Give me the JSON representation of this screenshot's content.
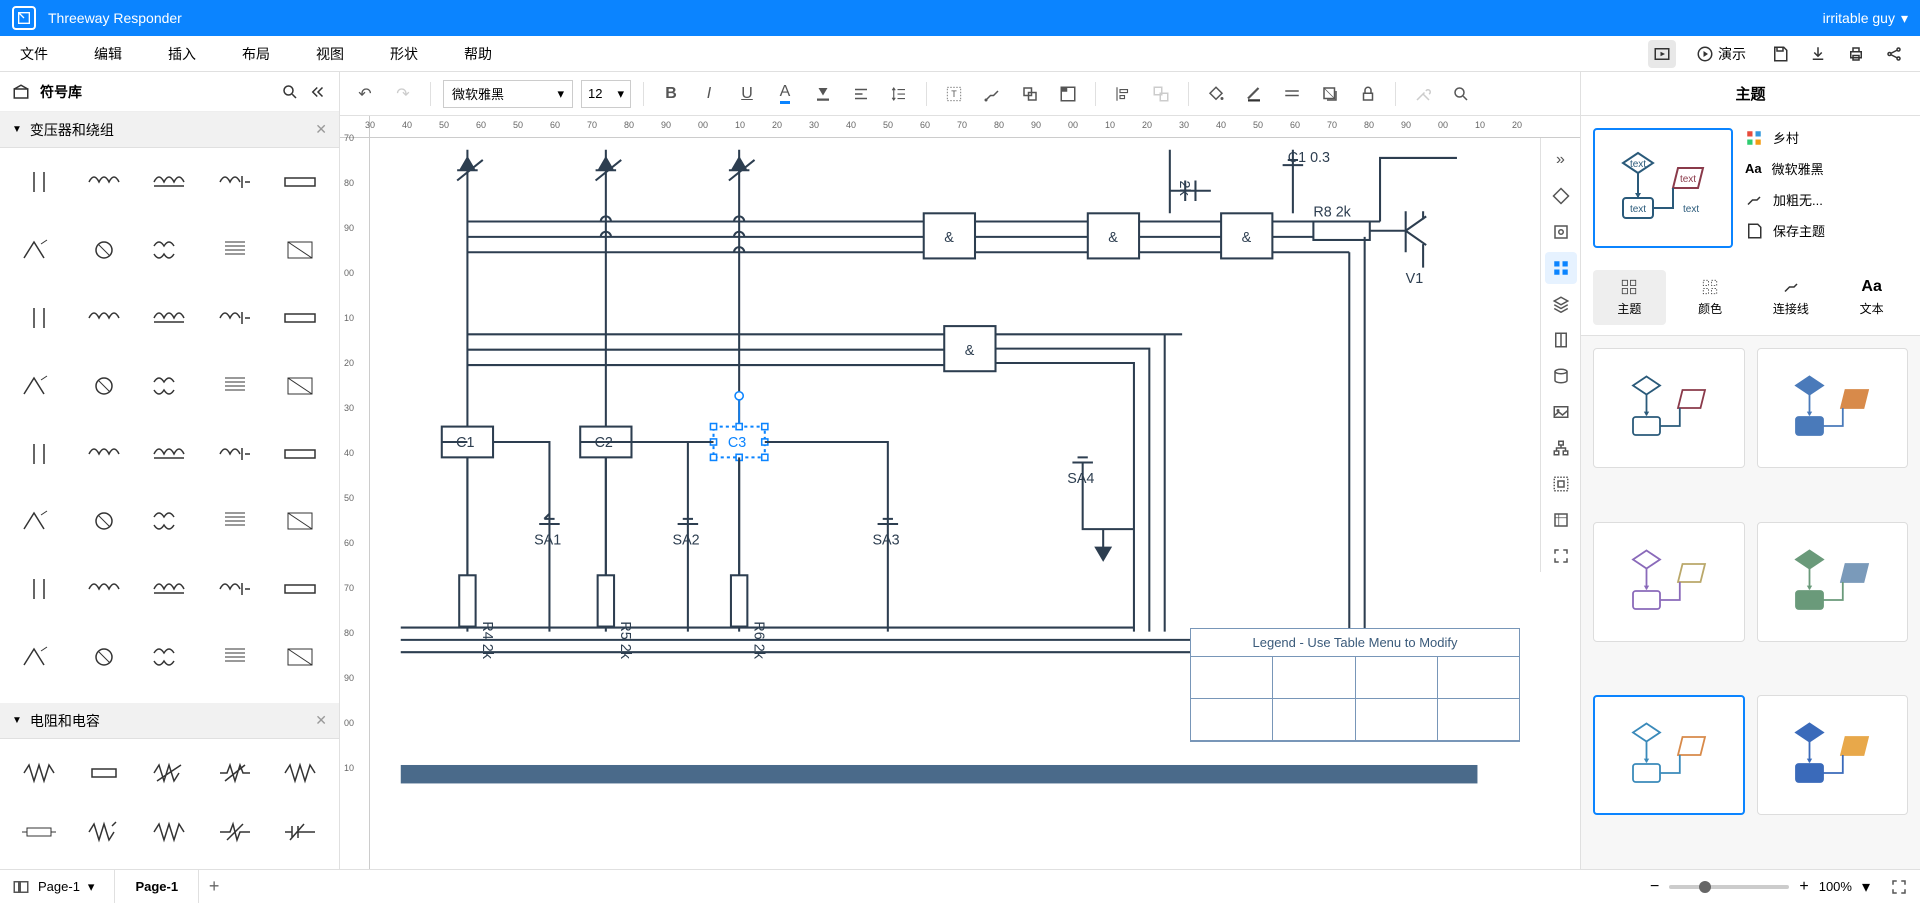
{
  "titlebar": {
    "app_name": "Threeway Responder",
    "user": "irritable guy"
  },
  "menubar": {
    "items": [
      "文件",
      "编辑",
      "插入",
      "布局",
      "视图",
      "形状",
      "帮助"
    ],
    "demo_label": "演示"
  },
  "toolbar": {
    "font": "微软雅黑",
    "size": "12"
  },
  "left_panel": {
    "title": "符号库",
    "cat1": "变压器和绕组",
    "cat2": "电阻和电容"
  },
  "ruler_h": [
    "30",
    "40",
    "50",
    "60",
    "50",
    "60",
    "70",
    "80",
    "90",
    "00",
    "10",
    "20",
    "30",
    "40",
    "50",
    "60",
    "70",
    "80",
    "90",
    "00",
    "10",
    "20",
    "30",
    "40",
    "50",
    "60",
    "70",
    "80",
    "90",
    "00",
    "10",
    "20"
  ],
  "ruler_v": [
    "70",
    "80",
    "90",
    "00",
    "10",
    "20",
    "30",
    "40",
    "50",
    "60",
    "70",
    "80",
    "90",
    "00",
    "10"
  ],
  "diagram": {
    "gates": [
      "&",
      "&",
      "&",
      "&"
    ],
    "labels": {
      "c1": "C1",
      "c2": "C2",
      "c3": "C3",
      "sa1": "SA1",
      "sa2": "SA2",
      "sa3": "SA3",
      "sa4": "SA4",
      "r4": "R4 2k",
      "r5": "R5 2k",
      "r6": "R6 2k",
      "r8": "R8 2k",
      "c10": "C1 0.3",
      "twok": "2k",
      "v1": "V1"
    },
    "legend_title": "Legend - Use Table Menu to Modify"
  },
  "right_panel": {
    "title": "主题",
    "preview_texts": [
      "text",
      "text",
      "text",
      "text"
    ],
    "options": [
      "乡村",
      "微软雅黑",
      "加粗无...",
      "保存主题"
    ],
    "tabs": [
      "主题",
      "颜色",
      "连接线",
      "文本"
    ]
  },
  "bottom": {
    "page_dropdown": "Page-1",
    "page_tab": "Page-1",
    "zoom": "100%"
  }
}
